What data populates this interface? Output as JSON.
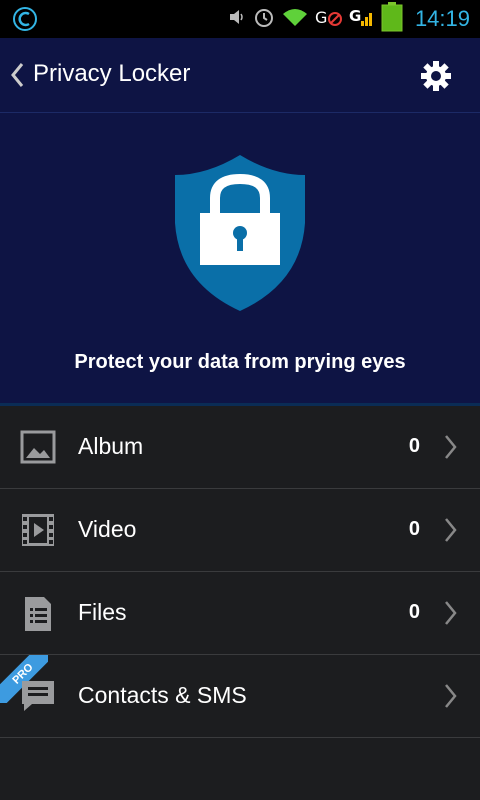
{
  "status_bar": {
    "time": "14:19",
    "icons": [
      "app-logo-icon",
      "volume-icon",
      "alarm-icon",
      "wifi-icon",
      "gps-icon",
      "signal-icon",
      "battery-icon"
    ]
  },
  "app_bar": {
    "title": "Privacy Locker",
    "back_icon": "chevron-left-icon",
    "settings_icon": "gear-icon"
  },
  "hero": {
    "tagline": "Protect your data from prying eyes",
    "shield_color": "#0a6fa8",
    "background": "#0e1444"
  },
  "items": [
    {
      "label": "Album",
      "count": "0",
      "icon": "image-icon"
    },
    {
      "label": "Video",
      "count": "0",
      "icon": "film-icon"
    },
    {
      "label": "Files",
      "count": "0",
      "icon": "document-icon"
    },
    {
      "label": "Contacts & SMS",
      "count": "",
      "icon": "message-icon",
      "badge": "PRO"
    }
  ],
  "colors": {
    "accent": "#33b5e5",
    "pro_badge": "#3d9be0",
    "list_bg": "#1c1d1f"
  }
}
